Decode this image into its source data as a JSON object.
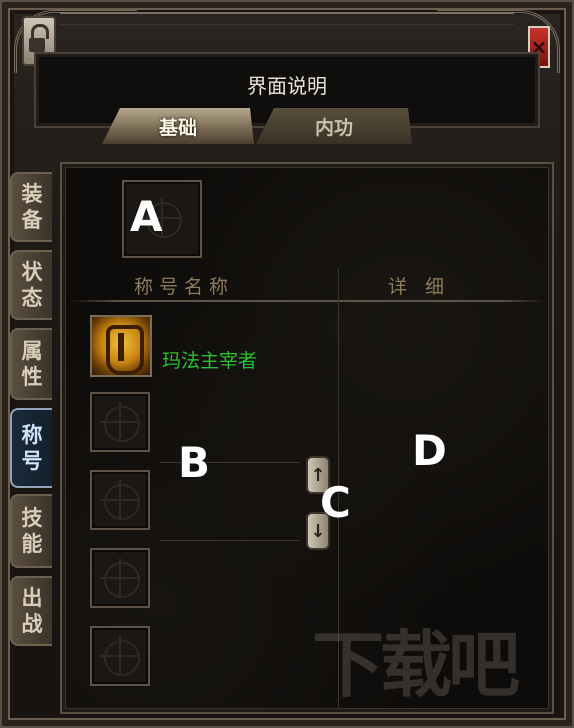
{
  "window": {
    "title": "界面说明",
    "close_label": "×"
  },
  "tabs": [
    {
      "label": "基础",
      "active": true
    },
    {
      "label": "内功",
      "active": false
    }
  ],
  "side_tabs": [
    {
      "label": "装备",
      "active": false
    },
    {
      "label": "状态",
      "active": false
    },
    {
      "label": "属性",
      "active": false
    },
    {
      "label": "称号",
      "active": true
    },
    {
      "label": "技能",
      "active": false
    },
    {
      "label": "出战",
      "active": false
    }
  ],
  "annotations": {
    "a": "A",
    "b": "B",
    "c": "C",
    "d": "D"
  },
  "columns": {
    "name": "称号名称",
    "detail": "详 细"
  },
  "titles": [
    {
      "name": "玛法主宰者",
      "icon": "golden-mask-icon"
    }
  ],
  "scroll": {
    "up": "↑",
    "down": "↓"
  },
  "watermark": "下载吧",
  "colors": {
    "title_name": "#2fbf35",
    "active_side_tab": "#1a2a3a",
    "close_button": "#c8332b"
  }
}
